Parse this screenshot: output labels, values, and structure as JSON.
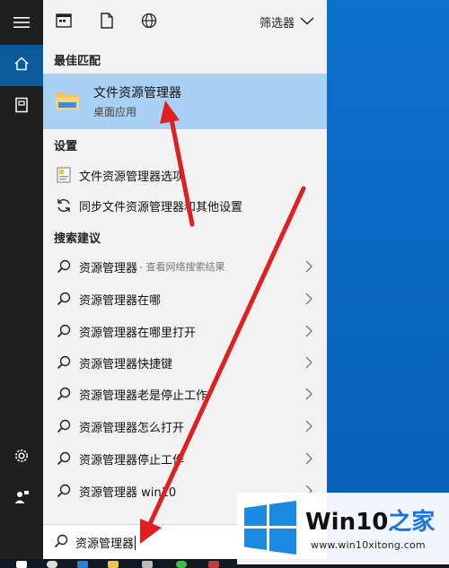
{
  "toolbar": {
    "icons": [
      "apps-icon",
      "document-icon",
      "web-icon"
    ],
    "filter_label": "筛选器"
  },
  "best_match": {
    "heading": "最佳匹配",
    "title": "文件资源管理器",
    "subtitle": "桌面应用"
  },
  "settings": {
    "heading": "设置",
    "items": [
      {
        "label": "文件资源管理器选项",
        "icon": "settings-page-icon"
      },
      {
        "label": "同步文件资源管理器和其他设置",
        "icon": "sync-icon"
      }
    ]
  },
  "suggestions": {
    "heading": "搜索建议",
    "items": [
      {
        "label": "资源管理器",
        "hint": " - 查看网络搜索结果"
      },
      {
        "label": "资源管理器在哪",
        "hint": ""
      },
      {
        "label": "资源管理器在哪里打开",
        "hint": ""
      },
      {
        "label": "资源管理器快捷键",
        "hint": ""
      },
      {
        "label": "资源管理器老是停止工作",
        "hint": ""
      },
      {
        "label": "资源管理器怎么打开",
        "hint": ""
      },
      {
        "label": "资源管理器停止工作",
        "hint": ""
      },
      {
        "label": "资源管理器 win10",
        "hint": ""
      }
    ]
  },
  "search": {
    "value": "资源管理器"
  },
  "watermark": {
    "brand_part1": "Win10",
    "brand_part2": "之家",
    "url": "www.win10xitong.com"
  },
  "colors": {
    "accent": "#0d5a9b",
    "highlight": "#a9d1f3",
    "arrow": "#e02020",
    "desktop": "#0a6fc9"
  }
}
